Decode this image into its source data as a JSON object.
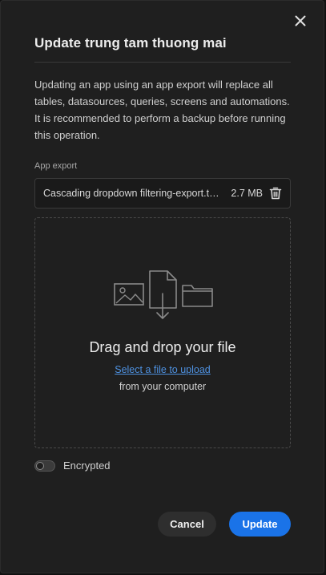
{
  "modal": {
    "title": "Update trung tam thuong mai",
    "description": "Updating an app using an app export will replace all tables, datasources, queries, screens and automations. It is recommended to perform a backup before running this operation.",
    "close_icon": "close-icon"
  },
  "app_export": {
    "label": "App export",
    "file_name": "Cascading dropdown filtering-export.tar.gz",
    "file_size": "2.7 MB",
    "remove_icon": "trash-icon"
  },
  "dropzone": {
    "title": "Drag and drop your file",
    "link_text": "Select a file to upload",
    "subtext": "from your computer",
    "icons": [
      "image-icon",
      "file-download-icon",
      "folder-icon"
    ]
  },
  "encrypted": {
    "label": "Encrypted",
    "checked": false
  },
  "actions": {
    "cancel_label": "Cancel",
    "update_label": "Update"
  },
  "colors": {
    "background": "#1f1f1f",
    "accent": "#1a73e8",
    "link": "#4e91e0"
  }
}
